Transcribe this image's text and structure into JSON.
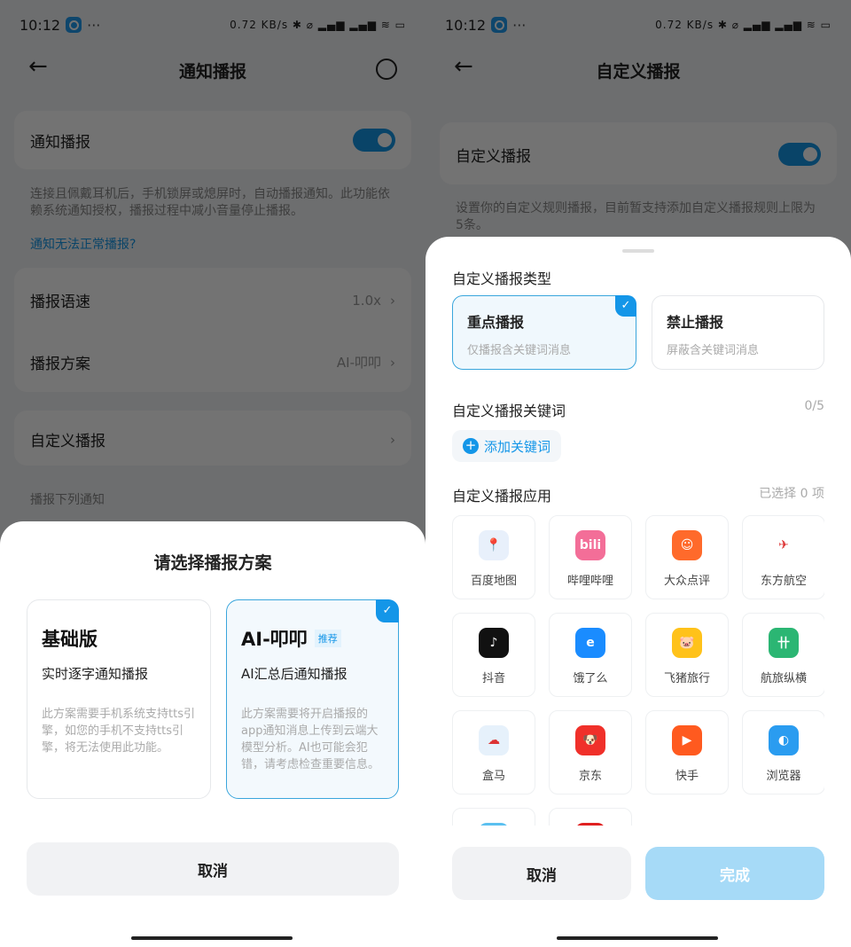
{
  "status": {
    "time": "10:12",
    "icons": "0.72 KB/s  ✱ ⌀ ▂▄▆ ▂▄▆ ≋ ▭"
  },
  "left": {
    "title": "通知播报",
    "toggle_label": "通知播报",
    "toggle_on": true,
    "desc": "连接且佩戴耳机后，手机锁屏或熄屏时，自动播报通知。此功能依赖系统通知授权，播报过程中减小音量停止播报。",
    "link": "通知无法正常播报?",
    "speed_label": "播报语速",
    "speed_value": "1.0x",
    "plan_label": "播报方案",
    "plan_value": "AI-叩叩",
    "custom_label": "自定义播报",
    "list_header": "播报下列通知",
    "sheet": {
      "title": "请选择播报方案",
      "plans": [
        {
          "name": "基础版",
          "sub": "实时逐字通知播报",
          "desc": "此方案需要手机系统支持tts引擎，如您的手机不支持tts引擎，将无法使用此功能。",
          "selected": false
        },
        {
          "name": "AI-叩叩",
          "badge": "推荐",
          "sub": "AI汇总后通知播报",
          "desc": "此方案需要将开启播报的app通知消息上传到云端大模型分析。AI也可能会犯错，请考虑检查重要信息。",
          "selected": true
        }
      ],
      "cancel": "取消"
    }
  },
  "right": {
    "title": "自定义播报",
    "toggle_label": "自定义播报",
    "toggle_on": true,
    "desc": "设置你的自定义规则播报，目前暂支持添加自定义播报规则上限为5条。",
    "sheet": {
      "type_header": "自定义播报类型",
      "types": [
        {
          "name": "重点播报",
          "desc": "仅播报含关键词消息",
          "selected": true
        },
        {
          "name": "禁止播报",
          "desc": "屏蔽含关键词消息",
          "selected": false
        }
      ],
      "keyword_header": "自定义播报关键词",
      "keyword_count": "0/5",
      "add_keyword": "添加关键词",
      "app_header": "自定义播报应用",
      "app_selected": "已选择 0 项",
      "apps": [
        {
          "name": "百度地图",
          "color": "#e8f0fb",
          "glyph": "📍"
        },
        {
          "name": "哔哩哔哩",
          "color": "#f36e98",
          "glyph": "bili"
        },
        {
          "name": "大众点评",
          "color": "#ff6a2b",
          "glyph": "☺"
        },
        {
          "name": "东方航空",
          "color": "#ffffff",
          "glyph": "✈"
        },
        {
          "name": "抖音",
          "color": "#111111",
          "glyph": "♪"
        },
        {
          "name": "饿了么",
          "color": "#1a8cff",
          "glyph": "e"
        },
        {
          "name": "飞猪旅行",
          "color": "#ffc21a",
          "glyph": "🐷"
        },
        {
          "name": "航旅纵横",
          "color": "#2bb673",
          "glyph": "卄"
        },
        {
          "name": "盒马",
          "color": "#e6f1fb",
          "glyph": "☁"
        },
        {
          "name": "京东",
          "color": "#f0302a",
          "glyph": "🐶"
        },
        {
          "name": "快手",
          "color": "#ff5a1f",
          "glyph": "▶"
        },
        {
          "name": "浏览器",
          "color": "#2a9cf0",
          "glyph": "◐"
        },
        {
          "name": "",
          "color": "#5bc0f0",
          "glyph": ""
        },
        {
          "name": "",
          "color": "#e02020",
          "glyph": ""
        }
      ],
      "cancel": "取消",
      "done": "完成"
    }
  },
  "colors": {
    "accent": "#1496e8",
    "done_disabled": "#a6daf7"
  }
}
